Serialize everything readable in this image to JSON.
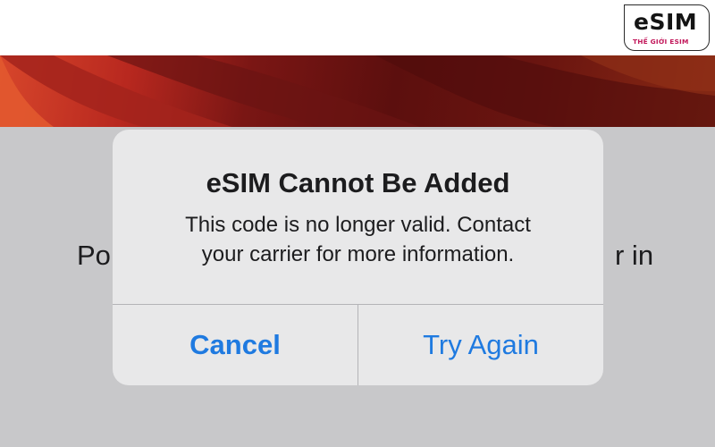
{
  "logo": {
    "word": "eSIM",
    "subtitle": "THẾ GIỚI ESIM",
    "accent_color": "#c2185b"
  },
  "background": {
    "text_left": "Po",
    "text_right": "r in"
  },
  "alert": {
    "title": "eSIM Cannot Be Added",
    "message_line1": "This code is no longer valid. Contact",
    "message_line2": "your carrier for more information.",
    "cancel_label": "Cancel",
    "retry_label": "Try Again",
    "button_color": "#1f7ae0"
  }
}
